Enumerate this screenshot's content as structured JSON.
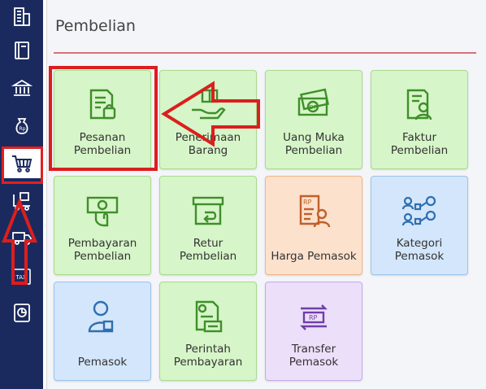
{
  "panel": {
    "title": "Pembelian"
  },
  "sidebar": {
    "items": [
      {
        "icon": "building-icon"
      },
      {
        "icon": "book-icon"
      },
      {
        "icon": "bank-icon"
      },
      {
        "icon": "money-bag-icon"
      },
      {
        "icon": "shopping-cart-icon",
        "active": true
      },
      {
        "icon": "delivery-icon"
      },
      {
        "icon": "truck-icon"
      },
      {
        "icon": "tax-icon",
        "label": "TAX"
      },
      {
        "icon": "report-icon"
      }
    ]
  },
  "tiles": [
    {
      "label": "Pesanan\nPembelian",
      "color": "green",
      "icon": "order-icon"
    },
    {
      "label": "Penerimaan\nBarang",
      "color": "green",
      "icon": "receive-goods-icon"
    },
    {
      "label": "Uang Muka\nPembelian",
      "color": "green",
      "icon": "down-payment-icon",
      "icon_text": "DP"
    },
    {
      "label": "Faktur\nPembelian",
      "color": "green",
      "icon": "invoice-icon"
    },
    {
      "label": "Pembayaran\nPembelian",
      "color": "green",
      "icon": "payment-icon"
    },
    {
      "label": "Retur\nPembelian",
      "color": "green",
      "icon": "return-icon"
    },
    {
      "label": "Harga Pemasok",
      "color": "orange",
      "icon": "supplier-price-icon",
      "icon_text": "RP"
    },
    {
      "label": "Kategori\nPemasok",
      "color": "blue",
      "icon": "supplier-category-icon"
    },
    {
      "label": "Pemasok",
      "color": "blue",
      "icon": "supplier-icon"
    },
    {
      "label": "Perintah\nPembayaran",
      "color": "green",
      "icon": "payment-order-icon"
    },
    {
      "label": "Transfer\nPemasok",
      "color": "purple",
      "icon": "supplier-transfer-icon",
      "icon_text": "RP"
    }
  ],
  "colors": {
    "sidebar_bg": "#1b2a5e",
    "highlight": "#dc1e1e",
    "green_icon": "#3f8f2a",
    "orange_icon": "#c0602a",
    "blue_icon": "#2f6fb0",
    "purple_icon": "#6f3fa8"
  }
}
